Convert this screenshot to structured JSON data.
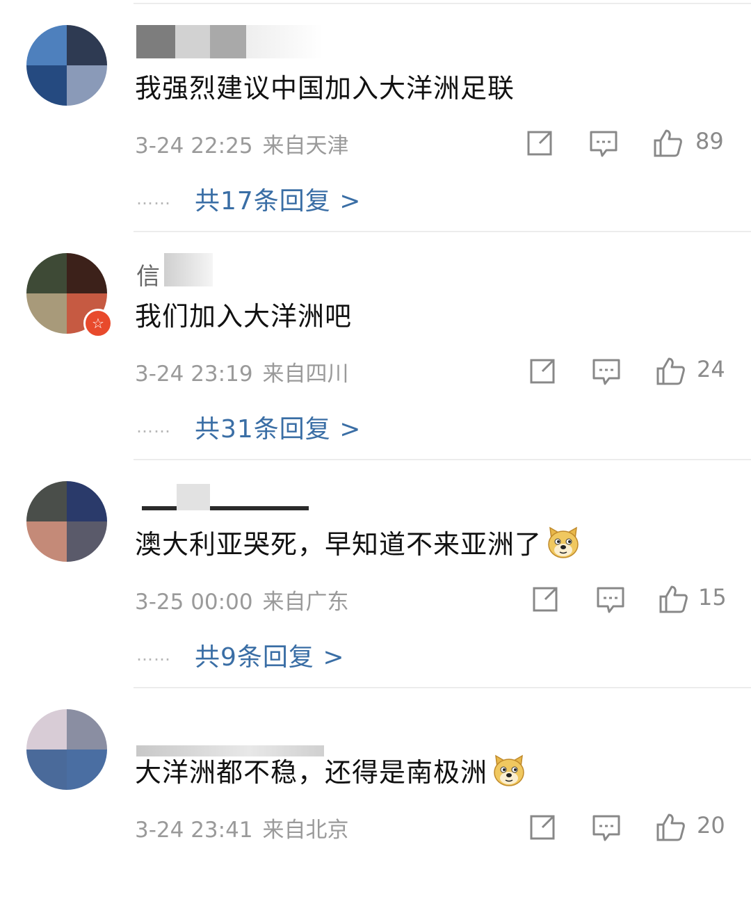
{
  "comments": [
    {
      "text": "我强烈建议中国加入大洋洲足联",
      "timestamp": "3-24 22:25",
      "location": "来自天津",
      "likes": "89",
      "replies_label": "共17条回复 >",
      "username_fragment": "",
      "has_emoji": false,
      "has_badge": false,
      "avatar_colors": [
        "#4e80bd",
        "#2e3a52",
        "#254a80",
        "#8a9ab8"
      ]
    },
    {
      "text": "我们加入大洋洲吧",
      "timestamp": "3-24 23:19",
      "location": "来自四川",
      "likes": "24",
      "replies_label": "共31条回复 >",
      "username_fragment": "信",
      "has_emoji": false,
      "has_badge": true,
      "avatar_colors": [
        "#3e4a36",
        "#3c211a",
        "#a89a7a",
        "#c65a42"
      ]
    },
    {
      "text": "澳大利亚哭死，早知道不来亚洲了",
      "timestamp": "3-25 00:00",
      "location": "来自广东",
      "likes": "15",
      "replies_label": "共9条回复 >",
      "username_fragment": "",
      "has_emoji": true,
      "has_badge": false,
      "avatar_colors": [
        "#4a4e4a",
        "#2a3a6a",
        "#c48a78",
        "#5a5a6a"
      ]
    },
    {
      "text": "大洋洲都不稳，还得是南极洲",
      "timestamp": "3-24 23:41",
      "location": "来自北京",
      "likes": "20",
      "replies_label": "",
      "username_fragment": "",
      "has_emoji": true,
      "has_badge": false,
      "avatar_colors": [
        "#d8ccd6",
        "#8a8ea2",
        "#4a6a9a",
        "#4a6ea2"
      ]
    }
  ],
  "icons": {
    "forward": "forward-icon",
    "reply": "comment-bubble-icon",
    "like": "thumbs-up-icon",
    "emoji": "doge-emoji-icon",
    "badge": "verified-star-badge-icon"
  },
  "colors": {
    "link": "#3a6ea5",
    "meta": "#9a9a9a",
    "text": "#111111",
    "badge": "#e84a2c"
  }
}
